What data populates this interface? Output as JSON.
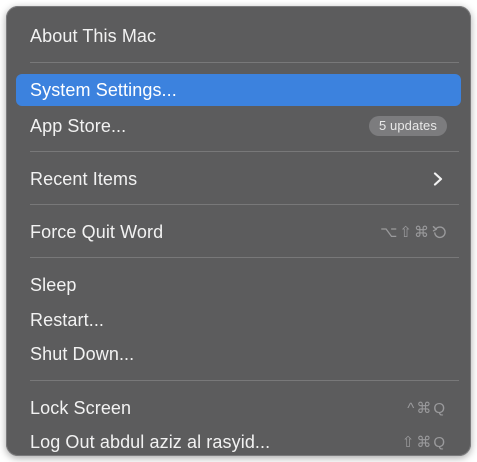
{
  "menu": {
    "about": "About This Mac",
    "system_settings": "System Settings...",
    "app_store": "App Store...",
    "app_store_badge": "5 updates",
    "recent_items": "Recent Items",
    "force_quit": "Force Quit Word",
    "force_quit_shortcut": "⌥⇧⌘",
    "sleep": "Sleep",
    "restart": "Restart...",
    "shut_down": "Shut Down...",
    "lock_screen": "Lock Screen",
    "lock_screen_shortcut": "^⌘Q",
    "log_out": "Log Out abdul aziz al rasyid...",
    "log_out_shortcut": "⇧⌘Q"
  },
  "colors": {
    "menu_background": "#5c5c5d",
    "highlight": "#3c82de",
    "separator": "#787879"
  }
}
